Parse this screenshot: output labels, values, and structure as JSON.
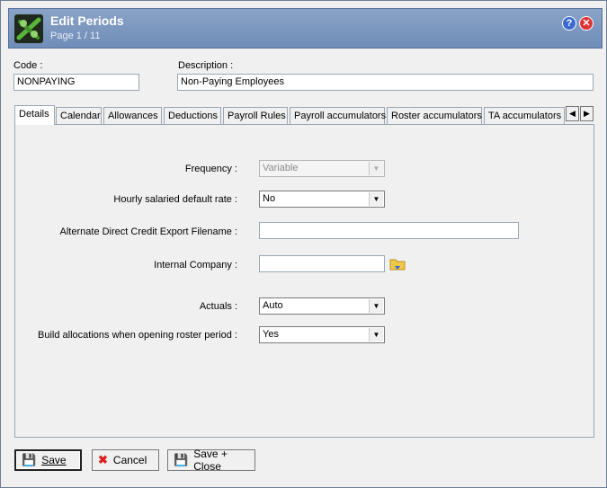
{
  "window": {
    "title": "Edit Periods",
    "subtitle": "Page 1 / 11"
  },
  "form": {
    "code_label": "Code :",
    "code_value": "NONPAYING",
    "description_label": "Description :",
    "description_value": "Non-Paying Employees"
  },
  "tabs": [
    "Details",
    "Calendar",
    "Allowances",
    "Deductions",
    "Payroll Rules",
    "Payroll accumulators",
    "Roster accumulators",
    "TA accumulators"
  ],
  "details": {
    "frequency_label": "Frequency :",
    "frequency_value": "Variable",
    "hourly_label": "Hourly salaried default rate :",
    "hourly_value": "No",
    "altcredit_label": "Alternate Direct Credit Export Filename :",
    "altcredit_value": "",
    "company_label": "Internal Company :",
    "company_value": "",
    "actuals_label": "Actuals :",
    "actuals_value": "Auto",
    "buildalloc_label": "Build allocations when opening roster period :",
    "buildalloc_value": "Yes"
  },
  "buttons": {
    "save": "Save",
    "cancel": "Cancel",
    "save_close": "Save + Close"
  },
  "colors": {
    "titlebar": "#7894bd",
    "accent": "#3c6bd0",
    "close": "#dd3333"
  }
}
